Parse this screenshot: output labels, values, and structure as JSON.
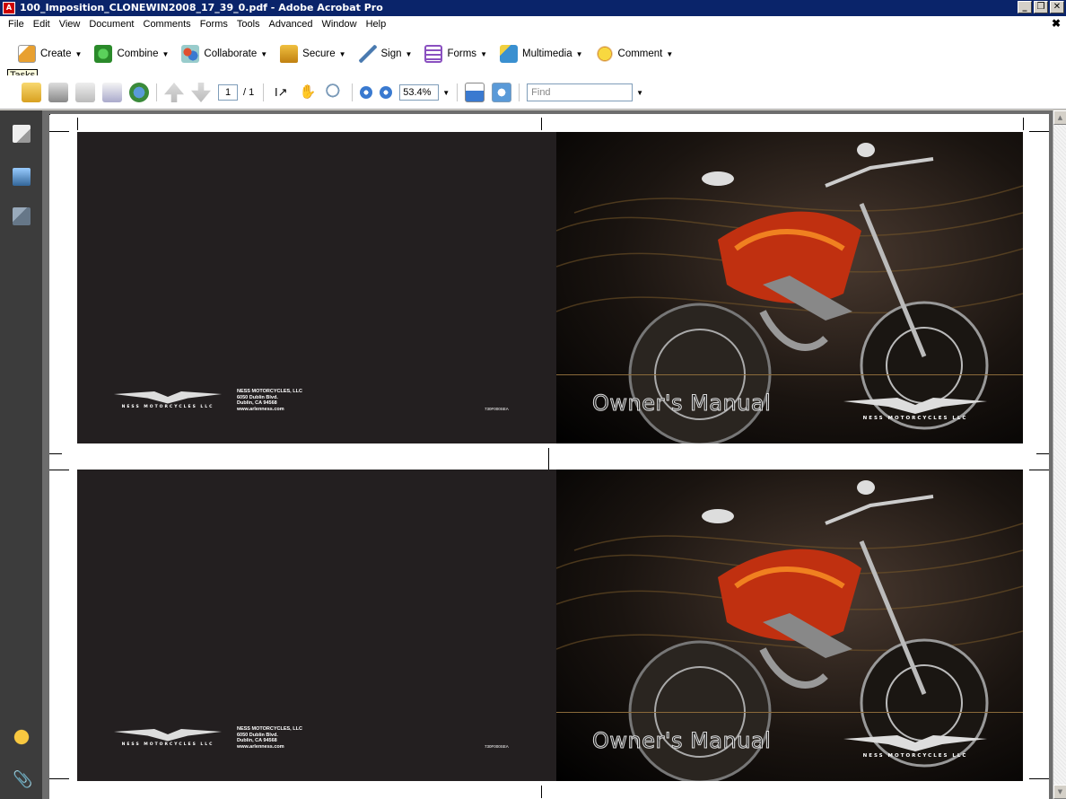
{
  "window": {
    "title": "100_Imposition_CLONEWIN2008_17_39_0.pdf - Adobe Acrobat Pro",
    "app_icon": "pdf-icon",
    "minimize": "_",
    "restore": "❒",
    "close": "✕"
  },
  "menu": [
    "File",
    "Edit",
    "View",
    "Document",
    "Comments",
    "Forms",
    "Tools",
    "Advanced",
    "Window",
    "Help"
  ],
  "menu_close": "✖",
  "tasks_tooltip": "Tasks",
  "tasks": [
    {
      "label": "Create",
      "icon": "create-icon",
      "color": "#e8a030"
    },
    {
      "label": "Combine",
      "icon": "combine-icon",
      "color": "#3aa03a"
    },
    {
      "label": "Collaborate",
      "icon": "collaborate-icon",
      "color": "#3a7ad0"
    },
    {
      "label": "Secure",
      "icon": "lock-icon",
      "color": "#d8a020"
    },
    {
      "label": "Sign",
      "icon": "pen-icon",
      "color": "#4a7ab0"
    },
    {
      "label": "Forms",
      "icon": "forms-icon",
      "color": "#8a50c0"
    },
    {
      "label": "Multimedia",
      "icon": "multimedia-icon",
      "color": "#3a90d0"
    },
    {
      "label": "Comment",
      "icon": "comment-icon",
      "color": "#f0c020"
    }
  ],
  "nav": {
    "page_number": "1",
    "page_total": "/ 1",
    "zoom": "53.4%",
    "find_placeholder": "Find"
  },
  "document": {
    "manual_title": "Owner's Manual",
    "company_lines": [
      "NESS MOTORCYCLES, LLC",
      "6050 Dublin Blvd.",
      "Dublin, CA 94568",
      "www.arlenness.com"
    ],
    "logo_text": "NESS MOTORCYCLES LLC",
    "part_number": "730F000SEA"
  }
}
